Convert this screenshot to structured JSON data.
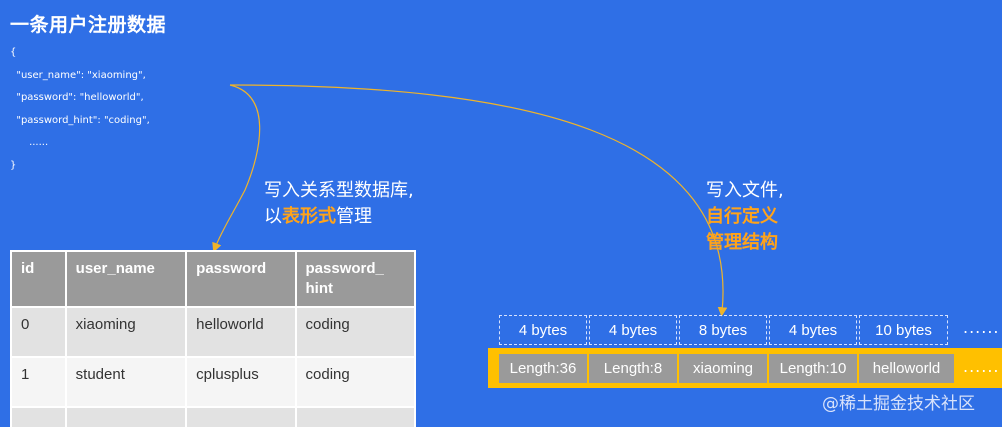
{
  "title": "一条用户注册数据",
  "json_lines": [
    "{",
    "  \"user_name\": \"xiaoming\",",
    "  \"password\": \"helloworld\",",
    "  \"password_hint\": \"coding\",",
    "      ......",
    "}"
  ],
  "annotation_table": {
    "line1": "写入关系型数据库,",
    "line2_prefix": "以",
    "line2_highlight": "表形式",
    "line2_suffix": "管理"
  },
  "annotation_file": {
    "line1": "写入文件,",
    "line2": "自行定义",
    "line3": "管理结构"
  },
  "table": {
    "headers": [
      "id",
      "user_name",
      "password",
      "password_\nhint"
    ],
    "rows": [
      [
        "0",
        "xiaoming",
        "helloworld",
        "coding"
      ],
      [
        "1",
        "student",
        "cplusplus",
        "coding"
      ],
      [
        "......",
        "......",
        "......",
        "......"
      ]
    ]
  },
  "byte_sizes": [
    "4 bytes",
    "4 bytes",
    "8 bytes",
    "4 bytes",
    "10 bytes"
  ],
  "byte_sizes_more": "......",
  "record_cells": [
    "Length:36",
    "Length:8",
    "xiaoming",
    "Length:10",
    "helloworld"
  ],
  "record_more": "......",
  "watermark": "@稀土掘金技术社区",
  "colors": {
    "background": "#2f6fe6",
    "highlight": "#ffa31a",
    "record_bar": "#ffc000",
    "cell_gray": "#9a9a9a",
    "arrow": "#f0b429"
  }
}
